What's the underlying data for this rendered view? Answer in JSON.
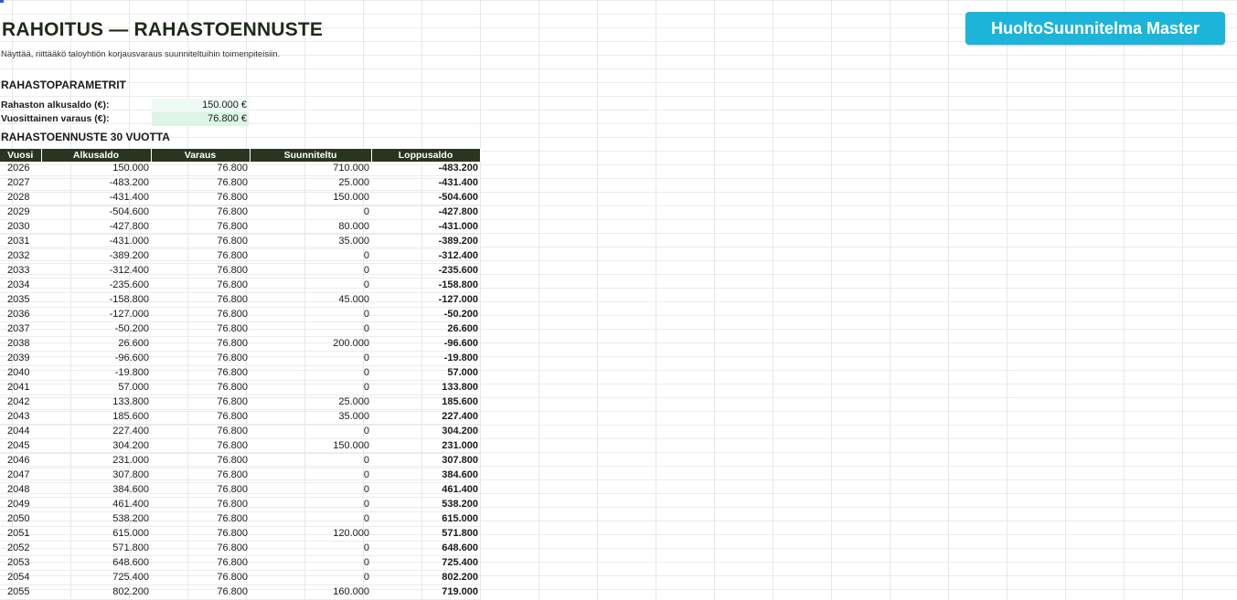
{
  "header": {
    "title": "RAHOITUS — RAHASTOENNUSTE",
    "subtitle": "Näyttää, riittääkö taloyhtiön korjausvaraus suunniteltuihin toimenpiteisiin.",
    "brand_button": "HuoltoSuunnitelma Master"
  },
  "params": {
    "heading": "RAHASTOPARAMETRIT",
    "start_label": "Rahaston alkusaldo (€):",
    "start_value": "150.000 €",
    "reserve_label": "Vuosittainen varaus (€):",
    "reserve_value": "76.800 €"
  },
  "forecast": {
    "heading": "RAHASTOENNUSTE 30 VUOTTA",
    "columns": [
      "Vuosi",
      "Alkusaldo",
      "Varaus",
      "Suunniteltu",
      "Loppusaldo"
    ],
    "rows": [
      [
        "2026",
        "150.000",
        "76.800",
        "710.000",
        "-483.200"
      ],
      [
        "2027",
        "-483.200",
        "76.800",
        "25.000",
        "-431.400"
      ],
      [
        "2028",
        "-431.400",
        "76.800",
        "150.000",
        "-504.600"
      ],
      [
        "2029",
        "-504.600",
        "76.800",
        "0",
        "-427.800"
      ],
      [
        "2030",
        "-427.800",
        "76.800",
        "80.000",
        "-431.000"
      ],
      [
        "2031",
        "-431.000",
        "76.800",
        "35.000",
        "-389.200"
      ],
      [
        "2032",
        "-389.200",
        "76.800",
        "0",
        "-312.400"
      ],
      [
        "2033",
        "-312.400",
        "76.800",
        "0",
        "-235.600"
      ],
      [
        "2034",
        "-235.600",
        "76.800",
        "0",
        "-158.800"
      ],
      [
        "2035",
        "-158.800",
        "76.800",
        "45.000",
        "-127.000"
      ],
      [
        "2036",
        "-127.000",
        "76.800",
        "0",
        "-50.200"
      ],
      [
        "2037",
        "-50.200",
        "76.800",
        "0",
        "26.600"
      ],
      [
        "2038",
        "26.600",
        "76.800",
        "200.000",
        "-96.600"
      ],
      [
        "2039",
        "-96.600",
        "76.800",
        "0",
        "-19.800"
      ],
      [
        "2040",
        "-19.800",
        "76.800",
        "0",
        "57.000"
      ],
      [
        "2041",
        "57.000",
        "76.800",
        "0",
        "133.800"
      ],
      [
        "2042",
        "133.800",
        "76.800",
        "25.000",
        "185.600"
      ],
      [
        "2043",
        "185.600",
        "76.800",
        "35.000",
        "227.400"
      ],
      [
        "2044",
        "227.400",
        "76.800",
        "0",
        "304.200"
      ],
      [
        "2045",
        "304.200",
        "76.800",
        "150.000",
        "231.000"
      ],
      [
        "2046",
        "231.000",
        "76.800",
        "0",
        "307.800"
      ],
      [
        "2047",
        "307.800",
        "76.800",
        "0",
        "384.600"
      ],
      [
        "2048",
        "384.600",
        "76.800",
        "0",
        "461.400"
      ],
      [
        "2049",
        "461.400",
        "76.800",
        "0",
        "538.200"
      ],
      [
        "2050",
        "538.200",
        "76.800",
        "0",
        "615.000"
      ],
      [
        "2051",
        "615.000",
        "76.800",
        "120.000",
        "571.800"
      ],
      [
        "2052",
        "571.800",
        "76.800",
        "0",
        "648.600"
      ],
      [
        "2053",
        "648.600",
        "76.800",
        "0",
        "725.400"
      ],
      [
        "2054",
        "725.400",
        "76.800",
        "0",
        "802.200"
      ],
      [
        "2055",
        "802.200",
        "76.800",
        "160.000",
        "719.000"
      ]
    ]
  },
  "colors": {
    "header_bg": "#2a3521",
    "brand": "#1cb4d8",
    "param_start_bg": "#eefaf4",
    "param_reserve_bg": "#dcf5e6"
  }
}
